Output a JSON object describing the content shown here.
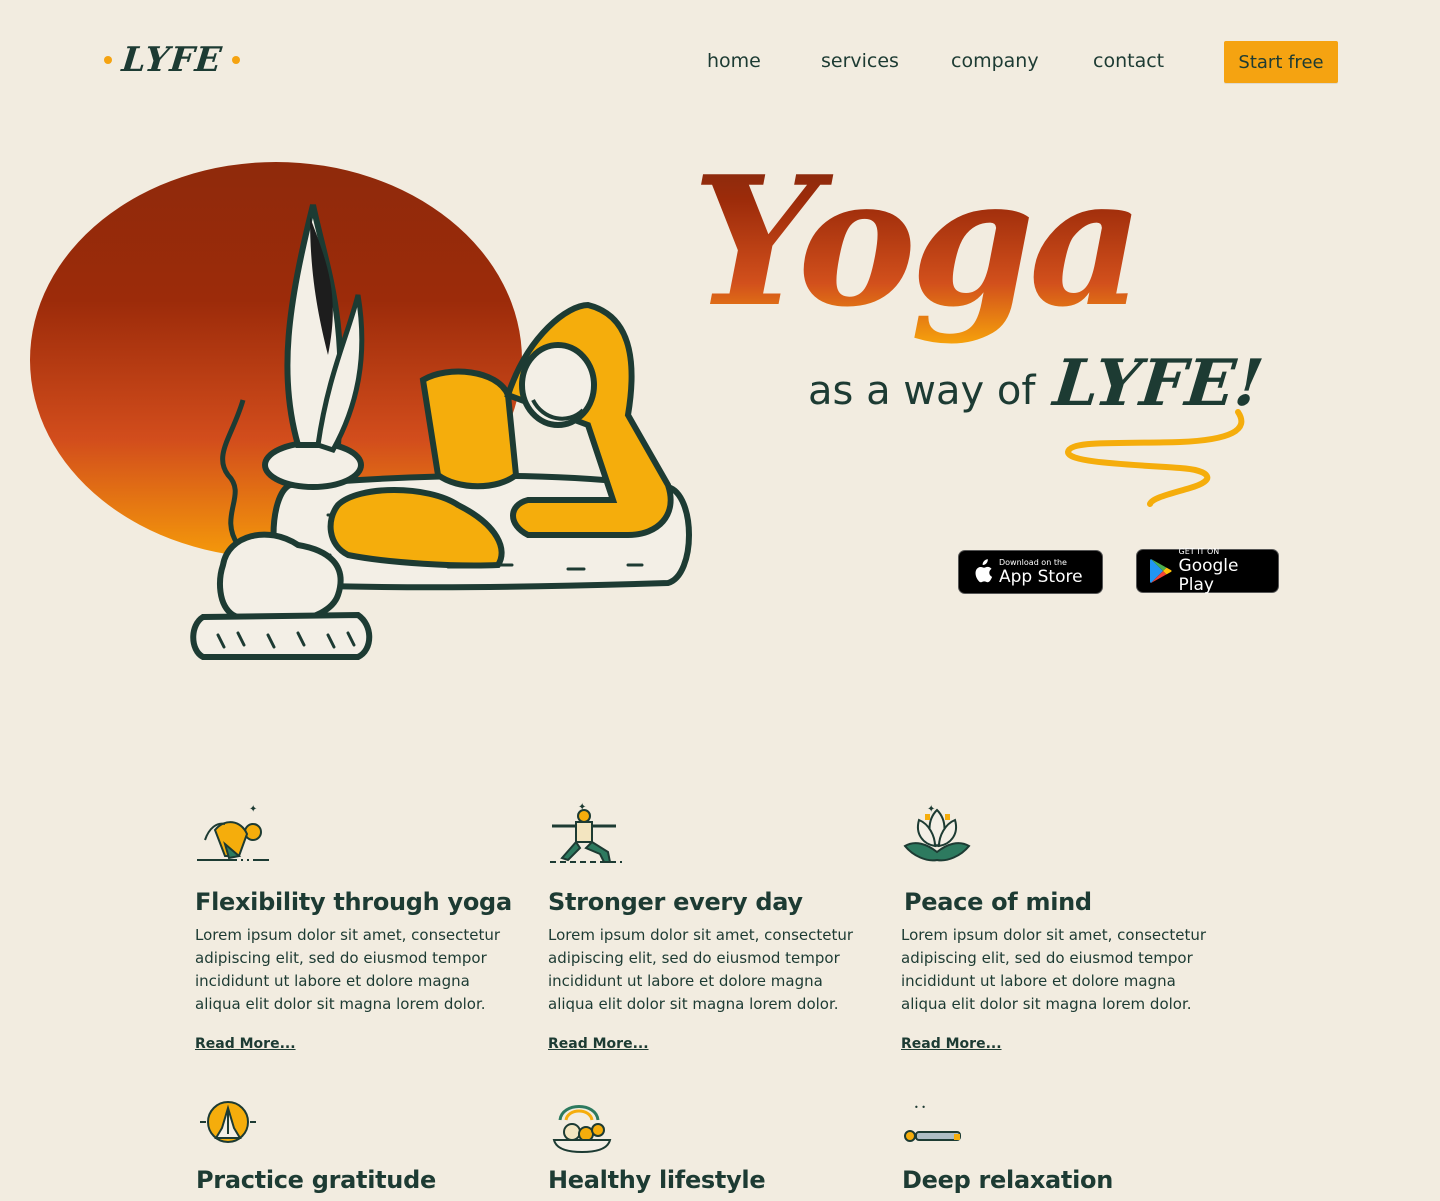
{
  "brand": {
    "name": "LYFE",
    "accent": "#f5a311",
    "dark": "#1d3b33",
    "background": "#f2ece0"
  },
  "nav": {
    "items": [
      {
        "label": "home"
      },
      {
        "label": "services"
      },
      {
        "label": "company"
      },
      {
        "label": "contact"
      }
    ],
    "cta": "Start free"
  },
  "hero": {
    "title": "Yoga",
    "tagline": "as a way of",
    "tagline_brand": "LYFE!",
    "illustration": "yoga-pose-with-cat-and-plant",
    "stores": {
      "apple": {
        "small": "Download on the",
        "big": "App Store",
        "icon": "apple-icon"
      },
      "google": {
        "small": "GET IT ON",
        "big": "Google Play",
        "icon": "google-play-icon"
      }
    }
  },
  "features": [
    {
      "icon": "bow-pose-icon",
      "title": "Flexibility through yoga",
      "text": "Lorem ipsum dolor sit amet, consectetur adipiscing elit, sed do eiusmod tempor incididunt ut labore et dolore magna aliqua elit dolor sit magna lorem dolor.",
      "link": "Read More..."
    },
    {
      "icon": "warrior-pose-icon",
      "title": "Stronger every day",
      "text": "Lorem ipsum dolor sit amet, consectetur adipiscing elit, sed do eiusmod tempor incididunt ut labore et dolore magna aliqua elit dolor sit magna lorem dolor.",
      "link": "Read More..."
    },
    {
      "icon": "lotus-icon",
      "title": "Peace of mind",
      "text": "Lorem ipsum dolor sit amet, consectetur adipiscing elit, sed do eiusmod tempor incididunt ut labore et dolore magna aliqua elit dolor sit magna lorem dolor.",
      "link": "Read More..."
    },
    {
      "icon": "praying-hands-icon",
      "title": "Practice gratitude"
    },
    {
      "icon": "healthy-food-icon",
      "title": "Healthy lifestyle"
    },
    {
      "icon": "lying-relaxation-icon",
      "title": "Deep relaxation"
    }
  ]
}
